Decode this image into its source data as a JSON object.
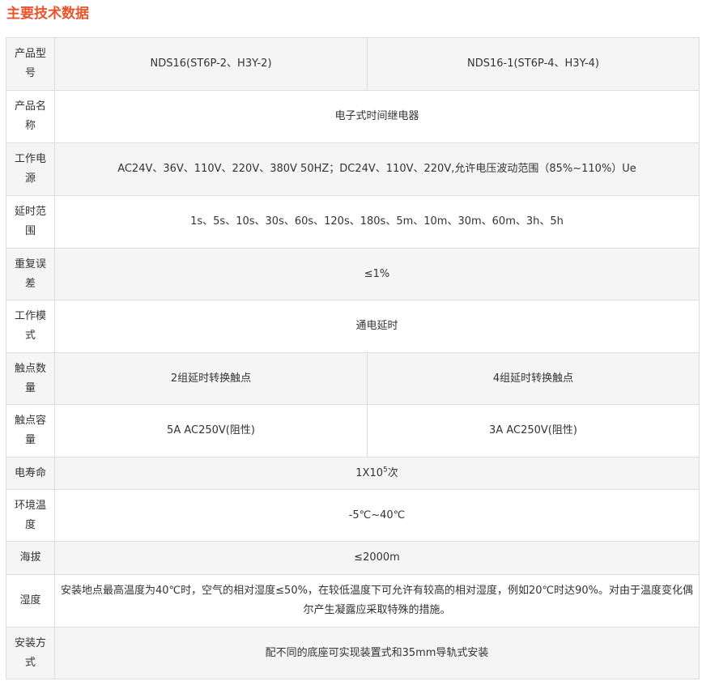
{
  "title": "主要技术数据",
  "rows": {
    "model": {
      "label": "产品型号",
      "col1": "NDS16(ST6P-2、H3Y-2)",
      "col2": "NDS16-1(ST6P-4、H3Y-4)"
    },
    "name": {
      "label": "产品名称",
      "value": "电子式时间继电器"
    },
    "power": {
      "label": "工作电源",
      "value": "AC24V、36V、110V、220V、380V 50HZ；DC24V、110V、220V,允许电压波动范围（85%~110%）Ue"
    },
    "delay": {
      "label": "延时范围",
      "value": "1s、5s、10s、30s、60s、120s、180s、5m、10m、30m、60m、3h、5h"
    },
    "repeat": {
      "label": "重复误差",
      "value": "≤1%"
    },
    "mode": {
      "label": "工作模式",
      "value": "通电延时"
    },
    "contacts": {
      "label": "触点数量",
      "col1": "2组延时转换触点",
      "col2": "4组延时转换触点"
    },
    "capacity": {
      "label": "触点容量",
      "col1": "5A AC250V(阻性)",
      "col2": "3A AC250V(阻性)"
    },
    "life": {
      "label": "电寿命",
      "base": "1X10",
      "exp": "5",
      "suffix": "次"
    },
    "temp": {
      "label": "环境温度",
      "value": "-5℃~40℃"
    },
    "altitude": {
      "label": "海拔",
      "value": "≤2000m"
    },
    "humidity": {
      "label": "湿度",
      "value": "安装地点最高温度为40℃时，空气的相对湿度≤50%，在较低温度下可允许有较高的相对湿度，例如20℃时达90%。对由于温度变化偶尔产生凝露应采取特殊的措施。"
    },
    "install": {
      "label": "安装方式",
      "value": "配不同的底座可实现装置式和35mm导轨式安装"
    }
  }
}
